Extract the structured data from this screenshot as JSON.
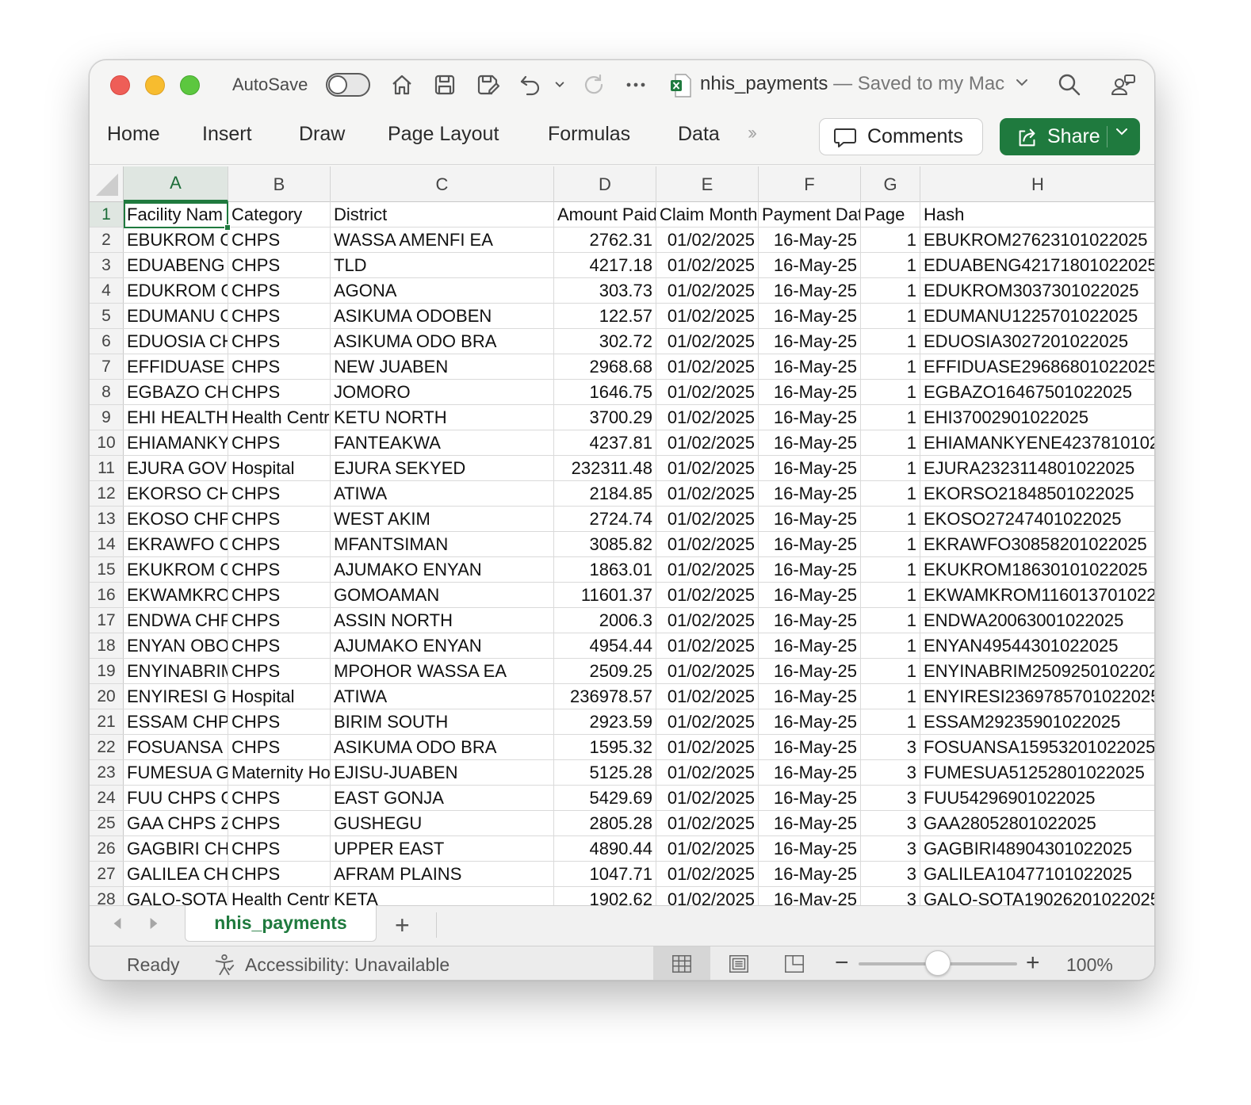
{
  "titlebar": {
    "autosave_label": "AutoSave",
    "autosave_on": false,
    "file_name": "nhis_payments",
    "save_status": " — Saved to my Mac"
  },
  "ribbon": {
    "menu": [
      "Home",
      "Insert",
      "Draw",
      "Page Layout",
      "Formulas",
      "Data"
    ],
    "comments_label": "Comments",
    "share_label": "Share"
  },
  "sheet": {
    "columns": [
      "A",
      "B",
      "C",
      "D",
      "E",
      "F",
      "G",
      "H"
    ],
    "selected_cell": "A1",
    "header_row": [
      "Facility Nam",
      "Category",
      "District",
      "Amount Paid",
      "Claim Month",
      "Payment Dat",
      "Page",
      "Hash"
    ],
    "rows": [
      [
        "EBUKROM CI",
        "CHPS",
        "WASSA AMENFI EA",
        "2762.31",
        "01/02/2025",
        "16-May-25",
        "1",
        "EBUKROM27623101022025"
      ],
      [
        "EDUABENG (",
        "CHPS",
        "TLD",
        "4217.18",
        "01/02/2025",
        "16-May-25",
        "1",
        "EDUABENG42171801022025"
      ],
      [
        "EDUKROM C",
        "CHPS",
        "AGONA",
        "303.73",
        "01/02/2025",
        "16-May-25",
        "1",
        "EDUKROM3037301022025"
      ],
      [
        "EDUMANU C",
        "CHPS",
        "ASIKUMA ODOBEN",
        "122.57",
        "01/02/2025",
        "16-May-25",
        "1",
        "EDUMANU1225701022025"
      ],
      [
        "EDUOSIA CH",
        "CHPS",
        "ASIKUMA ODO BRA",
        "302.72",
        "01/02/2025",
        "16-May-25",
        "1",
        "EDUOSIA3027201022025"
      ],
      [
        "EFFIDUASE C",
        "CHPS",
        "NEW JUABEN",
        "2968.68",
        "01/02/2025",
        "16-May-25",
        "1",
        "EFFIDUASE29686801022025"
      ],
      [
        "EGBAZO CHI",
        "CHPS",
        "JOMORO",
        "1646.75",
        "01/02/2025",
        "16-May-25",
        "1",
        "EGBAZO16467501022025"
      ],
      [
        "EHI HEALTH (",
        "Health Centr",
        "KETU NORTH",
        "3700.29",
        "01/02/2025",
        "16-May-25",
        "1",
        "EHI37002901022025"
      ],
      [
        "EHIAMANKYE",
        "CHPS",
        "FANTEAKWA",
        "4237.81",
        "01/02/2025",
        "16-May-25",
        "1",
        "EHIAMANKYENE42378101022025"
      ],
      [
        "EJURA GOVEI",
        "Hospital",
        "EJURA SEKYED",
        "232311.48",
        "01/02/2025",
        "16-May-25",
        "1",
        "EJURA2323114801022025"
      ],
      [
        "EKORSO CHI",
        "CHPS",
        "ATIWA",
        "2184.85",
        "01/02/2025",
        "16-May-25",
        "1",
        "EKORSO21848501022025"
      ],
      [
        "EKOSO CHPS",
        "CHPS",
        "WEST AKIM",
        "2724.74",
        "01/02/2025",
        "16-May-25",
        "1",
        "EKOSO27247401022025"
      ],
      [
        "EKRAWFO CI",
        "CHPS",
        "MFANTSIMAN",
        "3085.82",
        "01/02/2025",
        "16-May-25",
        "1",
        "EKRAWFO30858201022025"
      ],
      [
        "EKUKROM CI",
        "CHPS",
        "AJUMAKO ENYAN",
        "1863.01",
        "01/02/2025",
        "16-May-25",
        "1",
        "EKUKROM18630101022025"
      ],
      [
        "EKWAMKROI",
        "CHPS",
        "GOMOAMAN",
        "11601.37",
        "01/02/2025",
        "16-May-25",
        "1",
        "EKWAMKROM1160137010220"
      ],
      [
        "ENDWA CHP",
        "CHPS",
        "ASSIN NORTH",
        "2006.3",
        "01/02/2025",
        "16-May-25",
        "1",
        "ENDWA20063001022025"
      ],
      [
        "ENYAN OBOI",
        "CHPS",
        "AJUMAKO ENYAN",
        "4954.44",
        "01/02/2025",
        "16-May-25",
        "1",
        "ENYAN49544301022025"
      ],
      [
        "ENYINABRIM",
        "CHPS",
        "MPOHOR WASSA EA",
        "2509.25",
        "01/02/2025",
        "16-May-25",
        "1",
        "ENYINABRIM25092501022025"
      ],
      [
        "ENYIRESI GO",
        "Hospital",
        "ATIWA",
        "236978.57",
        "01/02/2025",
        "16-May-25",
        "1",
        "ENYIRESI2369785701022025"
      ],
      [
        "ESSAM CHPS",
        "CHPS",
        "BIRIM SOUTH",
        "2923.59",
        "01/02/2025",
        "16-May-25",
        "1",
        "ESSAM29235901022025"
      ],
      [
        "FOSUANSA C",
        "CHPS",
        "ASIKUMA ODO BRA",
        "1595.32",
        "01/02/2025",
        "16-May-25",
        "3",
        "FOSUANSA15953201022025"
      ],
      [
        "FUMESUA GC",
        "Maternity Ho",
        "EJISU-JUABEN",
        "5125.28",
        "01/02/2025",
        "16-May-25",
        "3",
        "FUMESUA51252801022025"
      ],
      [
        "FUU CHPS C(",
        "CHPS",
        "EAST GONJA",
        "5429.69",
        "01/02/2025",
        "16-May-25",
        "3",
        "FUU54296901022025"
      ],
      [
        "GAA CHPS ZC",
        "CHPS",
        "GUSHEGU",
        "2805.28",
        "01/02/2025",
        "16-May-25",
        "3",
        "GAA28052801022025"
      ],
      [
        "GAGBIRI CHI",
        "CHPS",
        "UPPER EAST",
        "4890.44",
        "01/02/2025",
        "16-May-25",
        "3",
        "GAGBIRI48904301022025"
      ],
      [
        "GALILEA CHP",
        "CHPS",
        "AFRAM PLAINS",
        "1047.71",
        "01/02/2025",
        "16-May-25",
        "3",
        "GALILEA10477101022025"
      ],
      [
        "GALO-SOTA I",
        "Health Centr",
        "KETA",
        "1902.62",
        "01/02/2025",
        "16-May-25",
        "3",
        "GALO-SOTA19026201022025"
      ]
    ]
  },
  "tabs": {
    "active_sheet": "nhis_payments",
    "add_label": "+"
  },
  "statusbar": {
    "ready": "Ready",
    "accessibility": "Accessibility: Unavailable",
    "zoom_minus": "−",
    "zoom_plus": "+",
    "zoom_label": "100%",
    "zoom_percent": 100
  },
  "icons": {
    "home": "home-icon",
    "save": "save-icon",
    "save_as": "save-as-icon",
    "undo": "undo-icon",
    "redo": "redo-icon",
    "more": "more-icon",
    "search": "search-icon",
    "collaborate": "collaborate-icon"
  },
  "colors": {
    "accent_green": "#1f7a3e",
    "close": "#ee5e57",
    "minimize": "#f7bc2f",
    "maximize": "#5cc73f"
  }
}
